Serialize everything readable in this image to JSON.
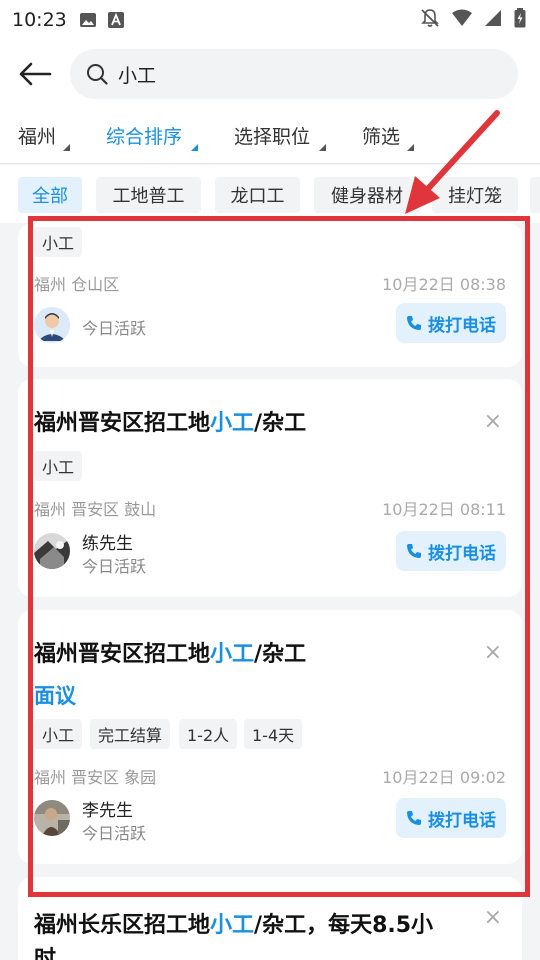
{
  "status_bar": {
    "time": "10:23"
  },
  "search": {
    "query": "小工"
  },
  "filters": [
    {
      "label": "福州"
    },
    {
      "label": "综合排序"
    },
    {
      "label": "选择职位"
    },
    {
      "label": "筛选"
    }
  ],
  "categories": [
    "全部",
    "工地普工",
    "龙口工",
    "健身器材",
    "挂灯笼"
  ],
  "colors": {
    "accent": "#1a8fe0",
    "annotation": "#e0363b"
  },
  "jobs": [
    {
      "tags": [
        "小工"
      ],
      "location": "福州 仓山区",
      "time": "10月22日 08:38",
      "activity": "今日活跃",
      "call_label": "拨打电话"
    },
    {
      "title_prefix": "福州晋安区招工地",
      "title_highlight": "小工",
      "title_suffix": "/杂工",
      "close_label": "×",
      "tags": [
        "小工"
      ],
      "location": "福州 晋安区 鼓山",
      "time": "10月22日 08:11",
      "contact": "练先生",
      "activity": "今日活跃",
      "call_label": "拨打电话"
    },
    {
      "title_prefix": "福州晋安区招工地",
      "title_highlight": "小工",
      "title_suffix": "/杂工",
      "close_label": "×",
      "wage": "面议",
      "tags": [
        "小工",
        "完工结算",
        "1-2人",
        "1-4天"
      ],
      "location": "福州 晋安区 象园",
      "time": "10月22日 09:02",
      "contact": "李先生",
      "activity": "今日活跃",
      "call_label": "拨打电话"
    },
    {
      "title_prefix": "福州长乐区招工地",
      "title_highlight": "小工",
      "title_suffix": "/杂工，每天8.5小",
      "title_line2": "时",
      "close_label": "×"
    }
  ]
}
